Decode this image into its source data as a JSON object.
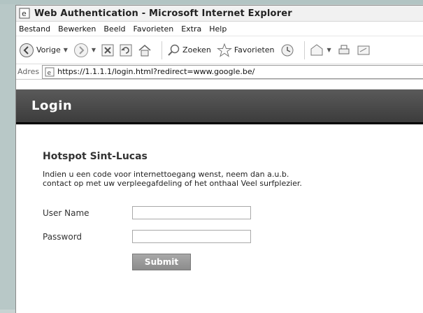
{
  "window": {
    "title": "Web Authentication - Microsoft Internet Explorer"
  },
  "menubar": {
    "items": [
      "Bestand",
      "Bewerken",
      "Beeld",
      "Favorieten",
      "Extra",
      "Help"
    ]
  },
  "toolbar": {
    "back_label": "Vorige",
    "search_label": "Zoeken",
    "favorites_label": "Favorieten"
  },
  "addressbar": {
    "label": "Adres",
    "url": "https://1.1.1.1/login.html?redirect=www.google.be/"
  },
  "page": {
    "header": "Login",
    "hotspot_title": "Hotspot Sint-Lucas",
    "info_text": "Indien u een code voor internettoegang wenst, neem dan a.u.b. contact op met uw verpleegafdeling of het onthaal Veel surfplezier.",
    "username_label": "User Name",
    "username_value": "",
    "password_label": "Password",
    "password_value": "",
    "submit_label": "Submit"
  },
  "colors": {
    "header_bg": "#4a4a4a",
    "header_border": "#000000",
    "submit_bg": "#999999"
  }
}
